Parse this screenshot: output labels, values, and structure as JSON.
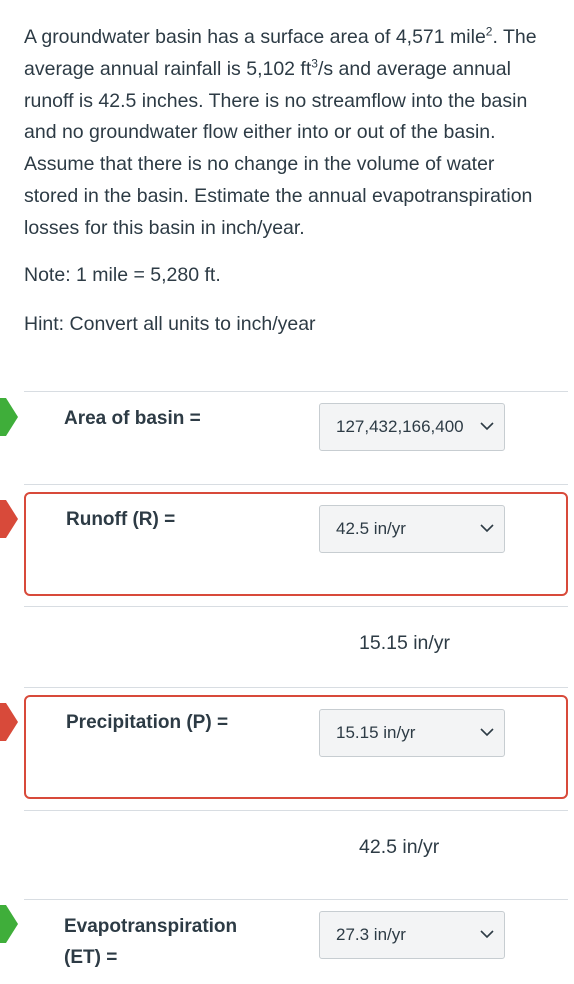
{
  "question": {
    "text_part1": "A groundwater basin has a surface area of 4,571 mile",
    "text_sup1": "2",
    "text_part2": ". The average annual rainfall is 5,102 ft",
    "text_sup2": "3",
    "text_part3": "/s and average annual runoff is 42.5 inches. There is no streamflow into the basin and no groundwater flow either into or out of the basin. Assume that there is no change in the volume of water stored in the basin. Estimate the annual evapotranspiration losses for this basin in inch/year.",
    "note": "Note: 1 mile = 5,280 ft.",
    "hint": "Hint: Convert all units to inch/year"
  },
  "items": [
    {
      "label": "Area of basin =",
      "selected": "127,432,166,400",
      "status": "correct",
      "status_color": "#3fae3a"
    },
    {
      "label": "Runoff (R) =",
      "selected": "42.5 in/yr",
      "status": "incorrect",
      "status_color": "#d84a3a",
      "correct_answer": "15.15 in/yr"
    },
    {
      "label": "Precipitation (P) =",
      "selected": "15.15 in/yr",
      "status": "incorrect",
      "status_color": "#d84a3a",
      "correct_answer": "42.5 in/yr"
    },
    {
      "label_line1": "Evapotranspiration",
      "label_line2": "(ET) =",
      "selected": "27.3 in/yr",
      "status": "correct",
      "status_color": "#3fae3a"
    }
  ],
  "icons": {
    "dropdown": "chevron-down-icon",
    "status_correct": "green-arrow-icon",
    "status_incorrect": "red-arrow-icon"
  }
}
